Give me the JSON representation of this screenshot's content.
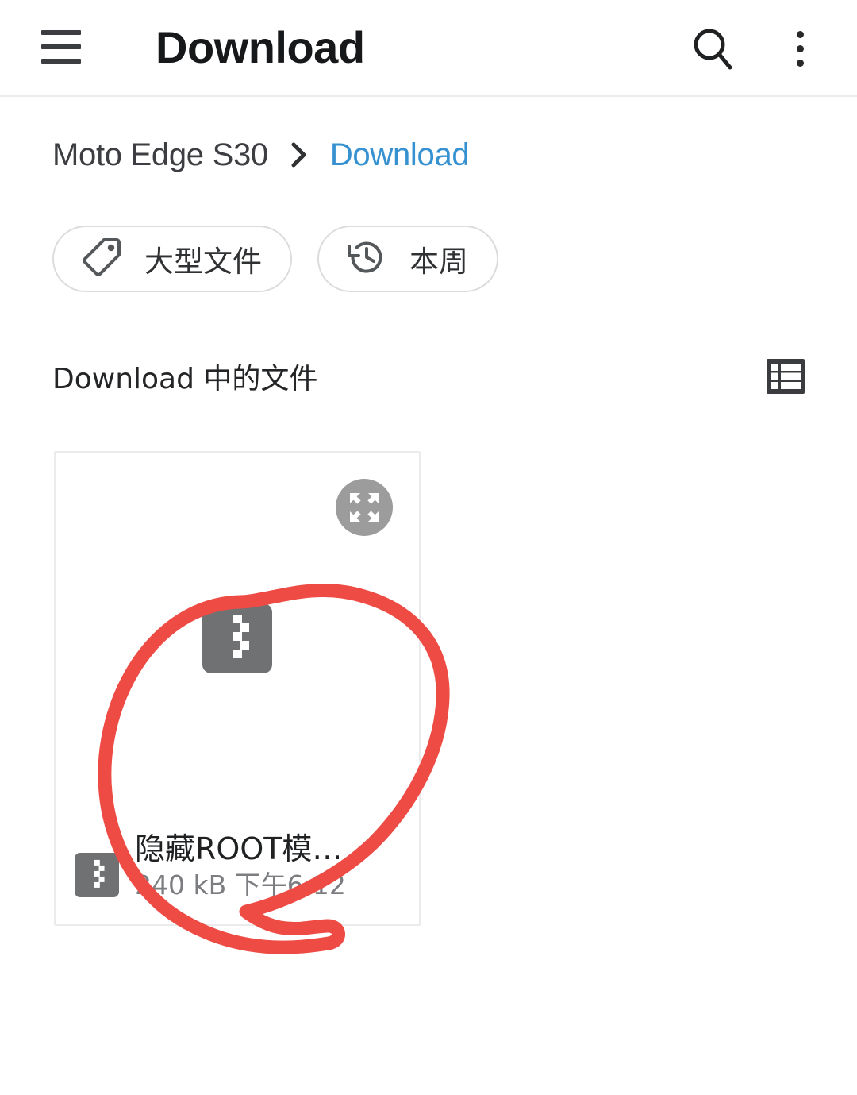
{
  "appbar": {
    "title": "Download",
    "menu_icon": "hamburger-menu-icon",
    "search_icon": "search-icon",
    "overflow_icon": "more-vertical-icon"
  },
  "breadcrumb": {
    "separator": "›",
    "items": [
      {
        "label": "Moto Edge S30",
        "active": false
      },
      {
        "label": "Download",
        "active": true
      }
    ]
  },
  "filter_chips": [
    {
      "label": "大型文件",
      "icon": "tag-icon"
    },
    {
      "label": "本周",
      "icon": "history-clock-icon"
    }
  ],
  "section": {
    "title": "Download 中的文件",
    "view_toggle_icon": "list-view-icon"
  },
  "files": [
    {
      "name": "隐藏ROOT模…",
      "size": "240 kB",
      "time": "下午6:12",
      "meta": "240 kB 下午6:12",
      "type_icon": "zip-archive-icon",
      "expand_icon": "expand-fullscreen-icon"
    }
  ],
  "annotation": {
    "shape": "hand-drawn-circle",
    "color": "#ee4b44",
    "stroke_width": 17
  },
  "colors": {
    "accent_link": "#3691d1",
    "text_primary": "#1f2123",
    "text_secondary": "#7b7d80",
    "chip_border": "#dcdcdc",
    "card_border": "#ebebeb",
    "icon_gray": "#6e7073",
    "annotation_red": "#ee4b44"
  }
}
